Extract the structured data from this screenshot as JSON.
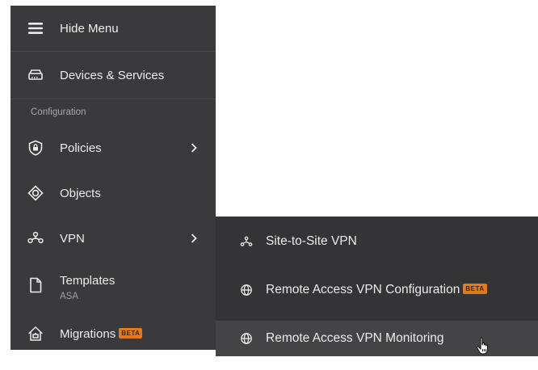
{
  "sidebar": {
    "hide_menu": "Hide Menu",
    "devices": "Devices & Services",
    "section": "Configuration",
    "policies": "Policies",
    "objects": "Objects",
    "vpn": "VPN",
    "templates": "Templates",
    "templates_sub": "ASA",
    "migrations": "Migrations",
    "beta_badge": "BETA"
  },
  "vpn_submenu": {
    "items": [
      {
        "label": "Site-to-Site VPN",
        "icon": "site-to-site-icon"
      },
      {
        "label": "Remote Access VPN Configuration",
        "icon": "globe-icon",
        "badge": "BETA"
      },
      {
        "label": "Remote Access VPN Monitoring",
        "icon": "globe-icon",
        "hovered": true
      }
    ]
  },
  "colors": {
    "sidebar_bg": "#3a3a3c",
    "submenu_bg": "#343436",
    "hover_bg": "#444446",
    "beta_badge": "#e07a1f"
  }
}
